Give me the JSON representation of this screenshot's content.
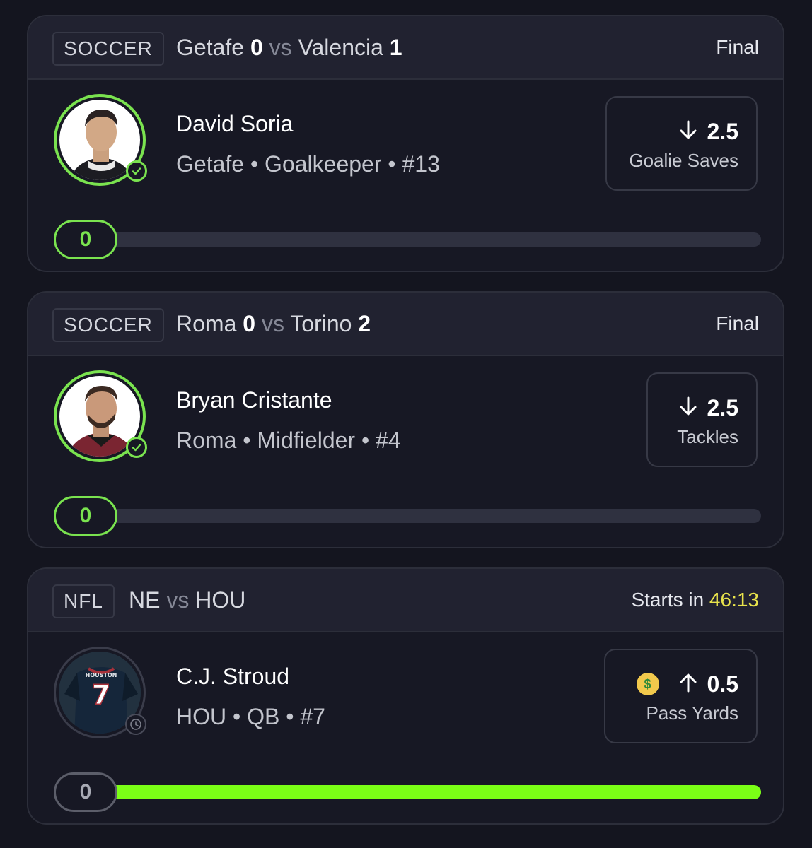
{
  "cards": [
    {
      "sport": "SOCCER",
      "home_team": "Getafe",
      "home_score": "0",
      "vs": "vs",
      "away_team": "Valencia",
      "away_score": "1",
      "status": "Final",
      "player_name": "David Soria",
      "player_info": "Getafe • Goalkeeper • #13",
      "pick_direction": "under",
      "pick_line": "2.5",
      "pick_stat": "Goalie Saves",
      "progress_value": "0",
      "progress_fraction": 0
    },
    {
      "sport": "SOCCER",
      "home_team": "Roma",
      "home_score": "0",
      "vs": "vs",
      "away_team": "Torino",
      "away_score": "2",
      "status": "Final",
      "player_name": "Bryan Cristante",
      "player_info": "Roma • Midfielder • #4",
      "pick_direction": "under",
      "pick_line": "2.5",
      "pick_stat": "Tackles",
      "progress_value": "0",
      "progress_fraction": 0
    },
    {
      "sport": "NFL",
      "home_team": "NE",
      "vs": "vs",
      "away_team": "HOU",
      "status_prefix": "Starts in",
      "countdown": "46:13",
      "player_name": "C.J. Stroud",
      "player_info": "HOU • QB • #7",
      "jersey_text": "HOUSTON",
      "jersey_number": "7",
      "pick_direction": "over",
      "pick_line": "0.5",
      "pick_stat": "Pass Yards",
      "pick_icon": "money-mouth-face-icon",
      "progress_value": "0",
      "progress_fraction": 1
    }
  ],
  "colors": {
    "background": "#14151f",
    "card": "#171824",
    "header": "#212230",
    "accent_green": "#7ae34f",
    "progress_green": "#7bff16",
    "countdown_yellow": "#e9e44c"
  }
}
